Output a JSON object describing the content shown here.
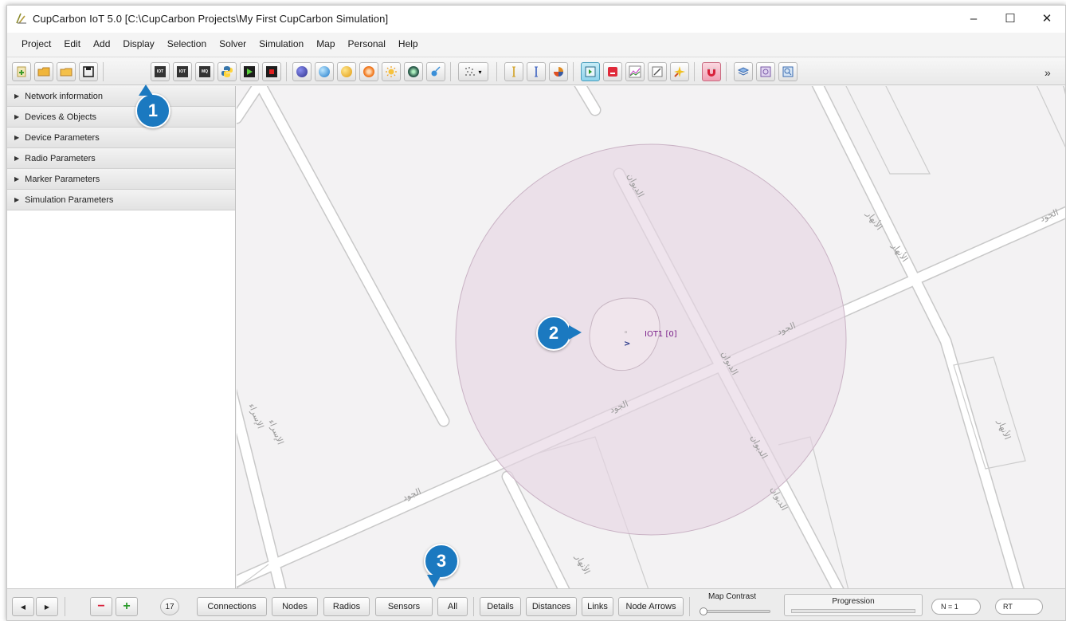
{
  "window": {
    "title": "CupCarbon IoT 5.0 [C:\\CupCarbon Projects\\My First CupCarbon Simulation]",
    "controls": {
      "minimize": "–",
      "maximize": "☐",
      "close": "✕"
    }
  },
  "menu": [
    "Project",
    "Edit",
    "Add",
    "Display",
    "Selection",
    "Solver",
    "Simulation",
    "Map",
    "Personal",
    "Help"
  ],
  "toolbar": {
    "chip_labels": [
      "IOT",
      "IOT",
      "MQ"
    ],
    "overflow": "»"
  },
  "left_panel": {
    "sections": [
      "Network information",
      "Devices & Objects",
      "Device Parameters",
      "Radio Parameters",
      "Marker Parameters",
      "Simulation Parameters"
    ]
  },
  "map": {
    "node_label": "IOT1 [0]",
    "node_arrow": ">",
    "node_glyph": "◦",
    "street_names": [
      "الجود",
      "الجود",
      "الجود",
      "الجود",
      "الديوان",
      "الديوان",
      "الديوان",
      "الديوان",
      "الأنهار",
      "الأنهار",
      "الأنهار",
      "الإسراء",
      "الإسراء",
      "الأنهار"
    ],
    "radio_range_color": "#e7d5e3",
    "node_label_color": "#7a1f8a"
  },
  "bottom_bar": {
    "nav_prev": "◀",
    "nav_next": "▶",
    "remove": "−",
    "add": "+",
    "node_count": "17",
    "filters": [
      "Connections",
      "Nodes",
      "Radios",
      "Sensors",
      "All"
    ],
    "views": [
      "Details",
      "Distances",
      "Links",
      "Node Arrows"
    ],
    "map_contrast_label": "Map Contrast",
    "progression_label": "Progression",
    "n_field": "N = 1",
    "rt_field": "RT"
  },
  "callouts": [
    "1",
    "2",
    "3"
  ],
  "colors": {
    "accent": "#1b79c0"
  }
}
